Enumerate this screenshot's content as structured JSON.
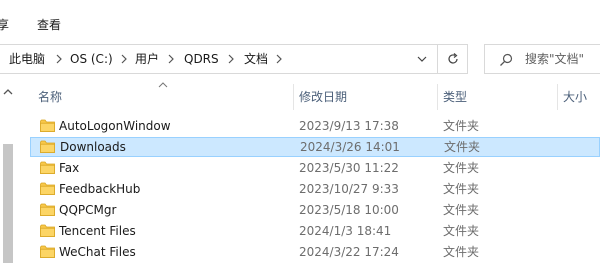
{
  "ribbon": {
    "tabs": [
      "享",
      "查看"
    ]
  },
  "address": {
    "crumbs": [
      "此电脑",
      "OS (C:)",
      "用户",
      "QDRS",
      "文档"
    ]
  },
  "search": {
    "placeholder": "搜索\"文档\""
  },
  "columns": {
    "name": "名称",
    "date": "修改日期",
    "type": "类型",
    "size": "大小"
  },
  "files": [
    {
      "name": "AutoLogonWindow",
      "date": "2023/9/13 17:38",
      "type": "文件夹",
      "selected": false
    },
    {
      "name": "Downloads",
      "date": "2024/3/26 14:01",
      "type": "文件夹",
      "selected": true
    },
    {
      "name": "Fax",
      "date": "2023/5/30 11:22",
      "type": "文件夹",
      "selected": false
    },
    {
      "name": "FeedbackHub",
      "date": "2023/10/27 9:33",
      "type": "文件夹",
      "selected": false
    },
    {
      "name": "QQPCMgr",
      "date": "2023/5/18 10:00",
      "type": "文件夹",
      "selected": false
    },
    {
      "name": "Tencent Files",
      "date": "2024/1/3 18:41",
      "type": "文件夹",
      "selected": false
    },
    {
      "name": "WeChat Files",
      "date": "2024/3/22 17:24",
      "type": "文件夹",
      "selected": false
    }
  ],
  "colors": {
    "selection_bg": "#cce8ff",
    "selection_border": "#99d1ff",
    "folder_yellow": "#f8c84a",
    "header_text": "#4c607a"
  }
}
